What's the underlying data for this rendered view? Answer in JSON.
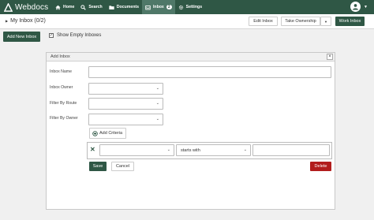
{
  "app": {
    "name": "Webdocs"
  },
  "nav": {
    "home": "Home",
    "search": "Search",
    "documents": "Documents",
    "inbox": "Inbox",
    "inbox_badge": "2",
    "settings": "Settings"
  },
  "subbar": {
    "title": "My Inbox (0/2)",
    "edit_inbox": "Edit Inbox",
    "take_ownership": "Take Ownership",
    "dropdown_caret": "▼",
    "work_inbox": "Work Inbox"
  },
  "toolbar": {
    "add_new_inbox": "Add New Inbox",
    "show_empty": "Show Empty Inboxes",
    "show_empty_checked": true
  },
  "modal": {
    "title": "Add Inbox",
    "close": "×",
    "labels": {
      "inbox_name": "Inbox Name",
      "inbox_owner": "Inbox Owner",
      "filter_route": "Filter By Route",
      "filter_owner": "Filter By Owner"
    },
    "values": {
      "inbox_name": "",
      "inbox_owner": "",
      "filter_route": "",
      "filter_owner": ""
    },
    "add_criteria": "Add Criteria",
    "criteria": {
      "field": "",
      "operator": "starts with",
      "value": ""
    },
    "save": "Save",
    "cancel": "Cancel",
    "delete": "Delete"
  }
}
